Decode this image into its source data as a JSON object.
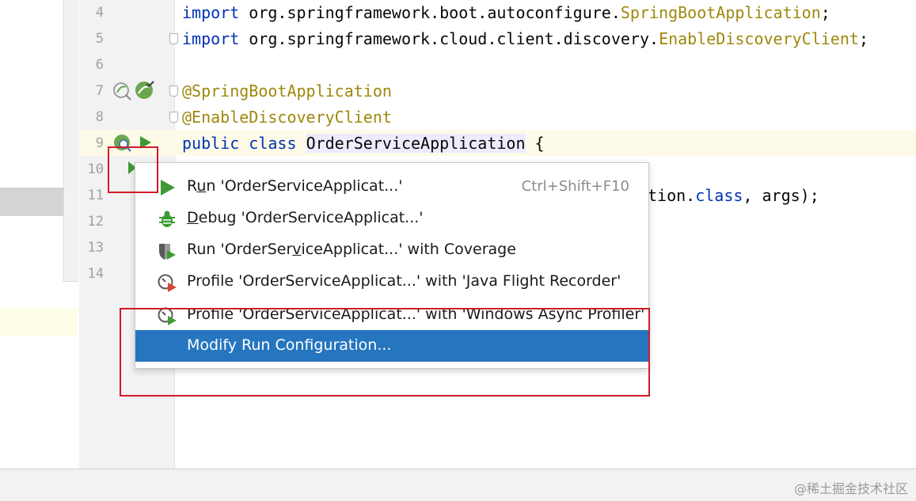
{
  "gutter": {
    "line_numbers": [
      "4",
      "5",
      "6",
      "7",
      "8",
      "9",
      "10",
      "11",
      "12",
      "13",
      "14"
    ]
  },
  "code": {
    "line4": {
      "kw": "import",
      "pkg": " org.springframework.boot.autoconfigure.",
      "cls": "SpringBootApplication",
      "end": ";"
    },
    "line5": {
      "kw": "import",
      "pkg": " org.springframework.cloud.client.discovery.",
      "cls": "EnableDiscoveryClient",
      "end": ";"
    },
    "line7": {
      "anno": "@SpringBootApplication"
    },
    "line8": {
      "anno": "@EnableDiscoveryClient"
    },
    "line9": {
      "kw1": "public",
      "kw2": "class",
      "name": "OrderServiceApplication",
      "brace": " {"
    },
    "line11_tail": {
      "a": "tion.",
      "kw": "class",
      "b": ", args);"
    }
  },
  "menu": {
    "items": [
      {
        "label": "Run 'OrderServiceApplicat...'",
        "mnemonic": "u",
        "shortcut": "Ctrl+Shift+F10",
        "icon": "run-icon"
      },
      {
        "label": "Debug 'OrderServiceApplicat...'",
        "mnemonic": "D",
        "icon": "debug-icon"
      },
      {
        "label": "Run 'OrderServiceApplicat...' with Coverage",
        "mnemonic": "v",
        "icon": "coverage-icon"
      },
      {
        "label": "Profile 'OrderServiceApplicat...' with 'Java Flight Recorder'",
        "icon": "profiler-icon"
      },
      {
        "label": "Profile 'OrderServiceApplicat...' with 'Windows Async Profiler'",
        "icon": "profiler-icon"
      },
      {
        "label": "Modify Run Configuration...",
        "icon": "none",
        "selected": true
      }
    ]
  },
  "watermark": "@稀土掘金技术社区",
  "colors": {
    "selection": "#2675bf",
    "annotation_box": "#d11a2a",
    "keyword": "#0033b3",
    "annotation": "#9e880d",
    "run_green": "#3d9b35"
  }
}
